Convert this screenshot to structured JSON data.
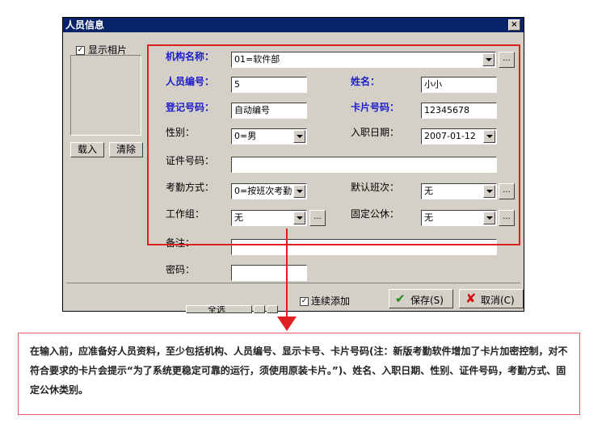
{
  "window": {
    "title": "人员信息",
    "close_label": "×"
  },
  "photo": {
    "show_label": "显示相片",
    "show_checked": true,
    "load_button": "载入",
    "clear_button": "清除"
  },
  "fields": {
    "org": {
      "label": "机构名称：",
      "value": "01=软件部"
    },
    "emp_no": {
      "label": "人员编号：",
      "value": "5"
    },
    "name": {
      "label": "姓名：",
      "value": "小小"
    },
    "reg_no": {
      "label": "登记号码：",
      "value": "自动编号"
    },
    "card_no": {
      "label": "卡片号码：",
      "value": "12345678"
    },
    "gender": {
      "label": "性别：",
      "value": "0=男"
    },
    "hire_date": {
      "label": "入职日期：",
      "value": "2007-01-12"
    },
    "id_no": {
      "label": "证件号码：",
      "value": ""
    },
    "attendance": {
      "label": "考勤方式：",
      "value": "0=按班次考勤"
    },
    "default_shift": {
      "label": "默认班次：",
      "value": "无"
    },
    "work_group": {
      "label": "工作组：",
      "value": "无"
    },
    "holiday": {
      "label": "固定公休：",
      "value": "无"
    },
    "remark": {
      "label": "备注：",
      "value": ""
    },
    "password": {
      "label": "密码：",
      "value": ""
    }
  },
  "footer": {
    "continuous_add": "连续添加",
    "continuous_checked": true,
    "save_button": "保存(S)",
    "cancel_button": "取消(C)",
    "partial_button": "全选"
  },
  "annotation": {
    "text": "在输入前，应准备好人员资料，至少包括机构、人员编号、显示卡号、卡片号码(注：新版考勤软件增加了卡片加密控制，对不符合要求的卡片会提示“为了系统更稳定可靠的运行，须使用原装卡片。”)、姓名、入职日期、性别、证件号码，考勤方式、固定公休类别。"
  },
  "colors": {
    "highlight": "#e02020",
    "titlebar": "#0a246a",
    "label_blue": "#1c1ccc"
  }
}
